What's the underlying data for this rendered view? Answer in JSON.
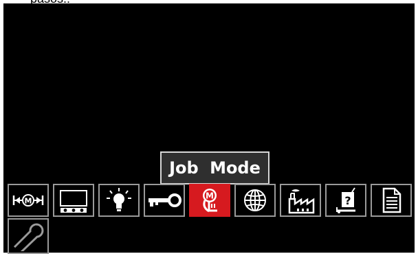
{
  "caption": "pasos.:",
  "popup": {
    "label": "Job  Mode"
  },
  "menu": {
    "items": [
      {
        "icon": "mode-selector-icon"
      },
      {
        "icon": "display-config-icon"
      },
      {
        "icon": "brightness-icon"
      },
      {
        "icon": "lock-key-icon"
      },
      {
        "icon": "job-mode-icon",
        "selected": true
      },
      {
        "icon": "language-globe-icon"
      },
      {
        "icon": "factory-reset-icon"
      },
      {
        "icon": "help-info-icon"
      },
      {
        "icon": "document-icon"
      },
      {
        "icon": "wrench-service-icon"
      }
    ]
  },
  "colors": {
    "screen": "#000000",
    "selected": "#d61a1f",
    "tile_border": "#9a9a9a"
  }
}
